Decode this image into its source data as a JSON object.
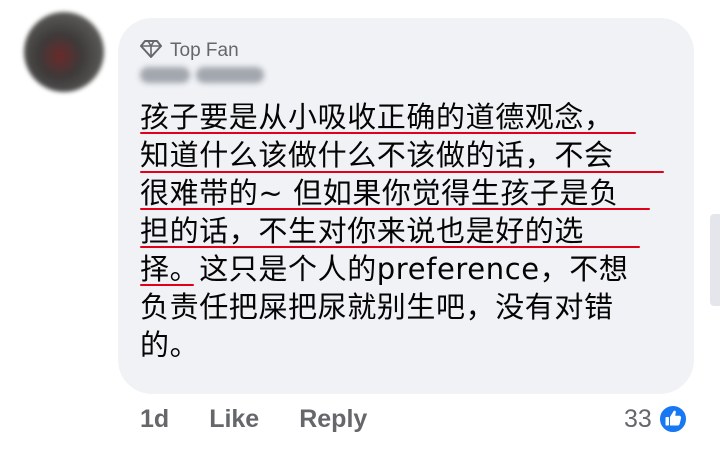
{
  "comment": {
    "badge_label": "Top Fan",
    "badge_icon": "diamond-icon",
    "lines": [
      "孩子要是从小吸收正确的道德观念，",
      "知道什么该做什么不该做的话，不会",
      "很难带的~ 但如果你觉得生孩子是负",
      "担的话，不生对你来说也是好的选",
      "择。这只是个人的preference，不想",
      "负责任把屎把尿就别生吧，没有对错",
      "的。"
    ]
  },
  "actions": {
    "time": "1d",
    "like_label": "Like",
    "reply_label": "Reply"
  },
  "reactions": {
    "count": "33",
    "icon": "thumbs-up-icon"
  },
  "colors": {
    "bubble": "#f0f2f5",
    "underline": "#e0001a",
    "secondary_text": "#65676b",
    "like_blue": "#1877f2"
  }
}
